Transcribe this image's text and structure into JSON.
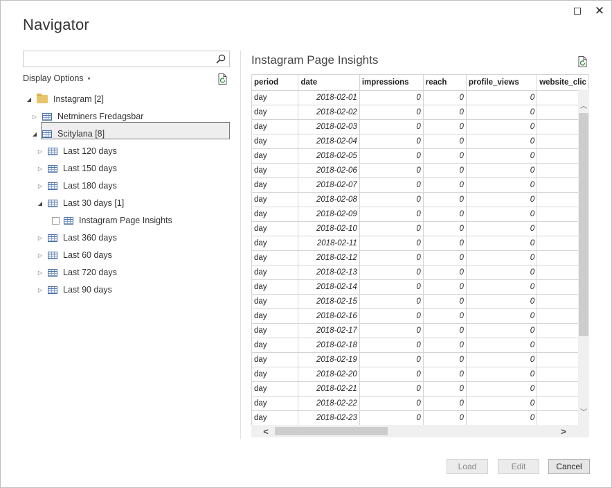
{
  "window": {
    "title": "Navigator",
    "maximize_icon": "maximize-icon",
    "close_icon": "close-icon",
    "close_glyph": "✕"
  },
  "left_pane": {
    "search": {
      "value": "",
      "placeholder": ""
    },
    "display_options_label": "Display Options",
    "display_options_caret": "▾",
    "tree": [
      {
        "label": "Instagram [2]",
        "level": 0,
        "state": "expanded",
        "icon": "folder-icon"
      },
      {
        "label": "Netminers Fredagsbar",
        "level": 1,
        "state": "collapsed",
        "icon": "table-icon"
      },
      {
        "label": "Scitylana [8]",
        "level": 1,
        "state": "expanded",
        "icon": "table-icon"
      },
      {
        "label": "Last 120 days",
        "level": 2,
        "state": "collapsed",
        "icon": "table-icon"
      },
      {
        "label": "Last 150 days",
        "level": 2,
        "state": "collapsed",
        "icon": "table-icon"
      },
      {
        "label": "Last 180 days",
        "level": 2,
        "state": "collapsed",
        "icon": "table-icon"
      },
      {
        "label": "Last 30 days [1]",
        "level": 2,
        "state": "expanded",
        "icon": "table-icon"
      },
      {
        "label": "Instagram Page Insights",
        "level": 3,
        "state": "leaf",
        "icon": "table-icon",
        "selected": true,
        "checked": false
      },
      {
        "label": "Last 360 days",
        "level": 2,
        "state": "collapsed",
        "icon": "table-icon"
      },
      {
        "label": "Last 60 days",
        "level": 2,
        "state": "collapsed",
        "icon": "table-icon"
      },
      {
        "label": "Last 720 days",
        "level": 2,
        "state": "collapsed",
        "icon": "table-icon"
      },
      {
        "label": "Last 90 days",
        "level": 2,
        "state": "collapsed",
        "icon": "table-icon"
      }
    ],
    "glyphs": {
      "expanded": "◢",
      "collapsed": "▷"
    }
  },
  "preview": {
    "title": "Instagram Page Insights",
    "columns": [
      "period",
      "date",
      "impressions",
      "reach",
      "profile_views",
      "website_clic"
    ],
    "rows": [
      [
        "day",
        "2018-02-01",
        "0",
        "0",
        "0",
        ""
      ],
      [
        "day",
        "2018-02-02",
        "0",
        "0",
        "0",
        ""
      ],
      [
        "day",
        "2018-02-03",
        "0",
        "0",
        "0",
        ""
      ],
      [
        "day",
        "2018-02-04",
        "0",
        "0",
        "0",
        ""
      ],
      [
        "day",
        "2018-02-05",
        "0",
        "0",
        "0",
        ""
      ],
      [
        "day",
        "2018-02-06",
        "0",
        "0",
        "0",
        ""
      ],
      [
        "day",
        "2018-02-07",
        "0",
        "0",
        "0",
        ""
      ],
      [
        "day",
        "2018-02-08",
        "0",
        "0",
        "0",
        ""
      ],
      [
        "day",
        "2018-02-09",
        "0",
        "0",
        "0",
        ""
      ],
      [
        "day",
        "2018-02-10",
        "0",
        "0",
        "0",
        ""
      ],
      [
        "day",
        "2018-02-11",
        "0",
        "0",
        "0",
        ""
      ],
      [
        "day",
        "2018-02-12",
        "0",
        "0",
        "0",
        ""
      ],
      [
        "day",
        "2018-02-13",
        "0",
        "0",
        "0",
        ""
      ],
      [
        "day",
        "2018-02-14",
        "0",
        "0",
        "0",
        ""
      ],
      [
        "day",
        "2018-02-15",
        "0",
        "0",
        "0",
        ""
      ],
      [
        "day",
        "2018-02-16",
        "0",
        "0",
        "0",
        ""
      ],
      [
        "day",
        "2018-02-17",
        "0",
        "0",
        "0",
        ""
      ],
      [
        "day",
        "2018-02-18",
        "0",
        "0",
        "0",
        ""
      ],
      [
        "day",
        "2018-02-19",
        "0",
        "0",
        "0",
        ""
      ],
      [
        "day",
        "2018-02-20",
        "0",
        "0",
        "0",
        ""
      ],
      [
        "day",
        "2018-02-21",
        "0",
        "0",
        "0",
        ""
      ],
      [
        "day",
        "2018-02-22",
        "0",
        "0",
        "0",
        ""
      ],
      [
        "day",
        "2018-02-23",
        "0",
        "0",
        "0",
        ""
      ]
    ],
    "scroll_glyphs": {
      "up": "︿",
      "down": "﹀",
      "left": "<",
      "right": ">"
    }
  },
  "footer": {
    "load_label": "Load",
    "edit_label": "Edit",
    "cancel_label": "Cancel"
  },
  "colors": {
    "folder": "#e8c46b",
    "table_icon": "#4a6fa5",
    "disabled_text": "#8a8a8a",
    "selection_border": "#7a7a7a"
  }
}
